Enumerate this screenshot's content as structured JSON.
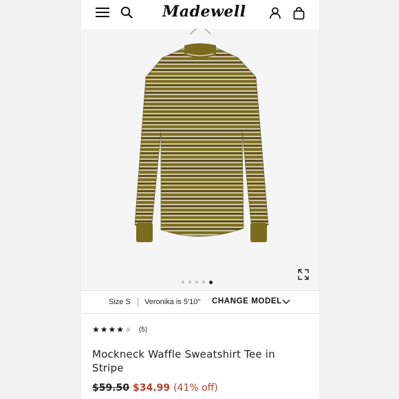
{
  "brand": {
    "logo_text": "Madewell"
  },
  "header": {
    "icons": [
      "menu-icon",
      "search-icon",
      "account-icon",
      "bag-icon"
    ]
  },
  "gallery": {
    "image_count": 5,
    "active_index": 4,
    "product_colors": {
      "base": "#7c6d22",
      "stripe_light": "#e6e0c7",
      "stripe_dark": "#3d3522",
      "collar": "#7a6b1f"
    }
  },
  "model_bar": {
    "size_label": "Size S",
    "model_height": "Veronika is 5'10\"",
    "change_model_label": "CHANGE MODEL"
  },
  "rating": {
    "stars_filled": 4,
    "stars_total": 5,
    "count_label": "(5)"
  },
  "product": {
    "title": "Mockneck Waffle Sweatshirt Tee in Stripe",
    "price_original": "$59.50",
    "price_sale": "$34.99",
    "discount_label": "(41% off)"
  },
  "colors": {
    "sale": "#b3402a",
    "text": "#222222",
    "side_panel": "#f0f0f0"
  }
}
